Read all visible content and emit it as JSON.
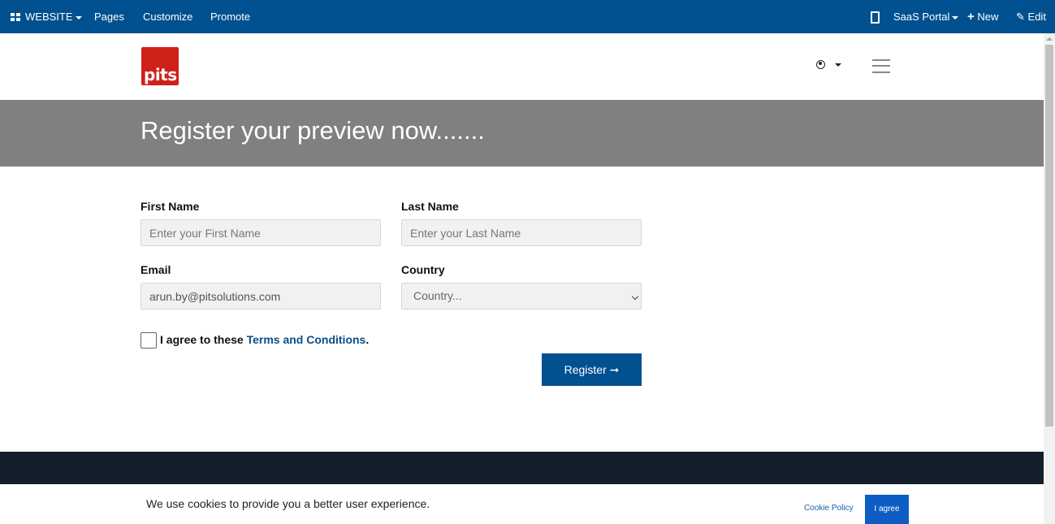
{
  "topbar": {
    "website_label": "WEBSITE",
    "pages_label": "Pages",
    "customize_label": "Customize",
    "promote_label": "Promote",
    "saas_portal_label": "SaaS Portal",
    "new_label": "New",
    "edit_label": "Edit",
    "bg_color": "#01508f"
  },
  "header": {
    "logo_text": "pits",
    "logo_color": "#d0201a"
  },
  "banner": {
    "title": "Register your preview now......."
  },
  "form": {
    "first_name": {
      "label": "First Name",
      "placeholder": "Enter your First Name",
      "value": ""
    },
    "last_name": {
      "label": "Last Name",
      "placeholder": "Enter your Last Name",
      "value": ""
    },
    "email": {
      "label": "Email",
      "value": "arun.by@pitsolutions.com"
    },
    "country": {
      "label": "Country",
      "selected": "Country..."
    },
    "agree_text": "I agree to these",
    "terms_link": "Terms and Conditions",
    "agree_period": ".",
    "register_label": "Register",
    "register_arrow": "➞"
  },
  "cookie_bar": {
    "message": "We use cookies to provide you a better user experience.",
    "policy_link": "Cookie Policy",
    "agree_button": "I agree"
  },
  "colors": {
    "primary": "#01508f",
    "banner": "#808080",
    "footer": "#141d2b"
  }
}
